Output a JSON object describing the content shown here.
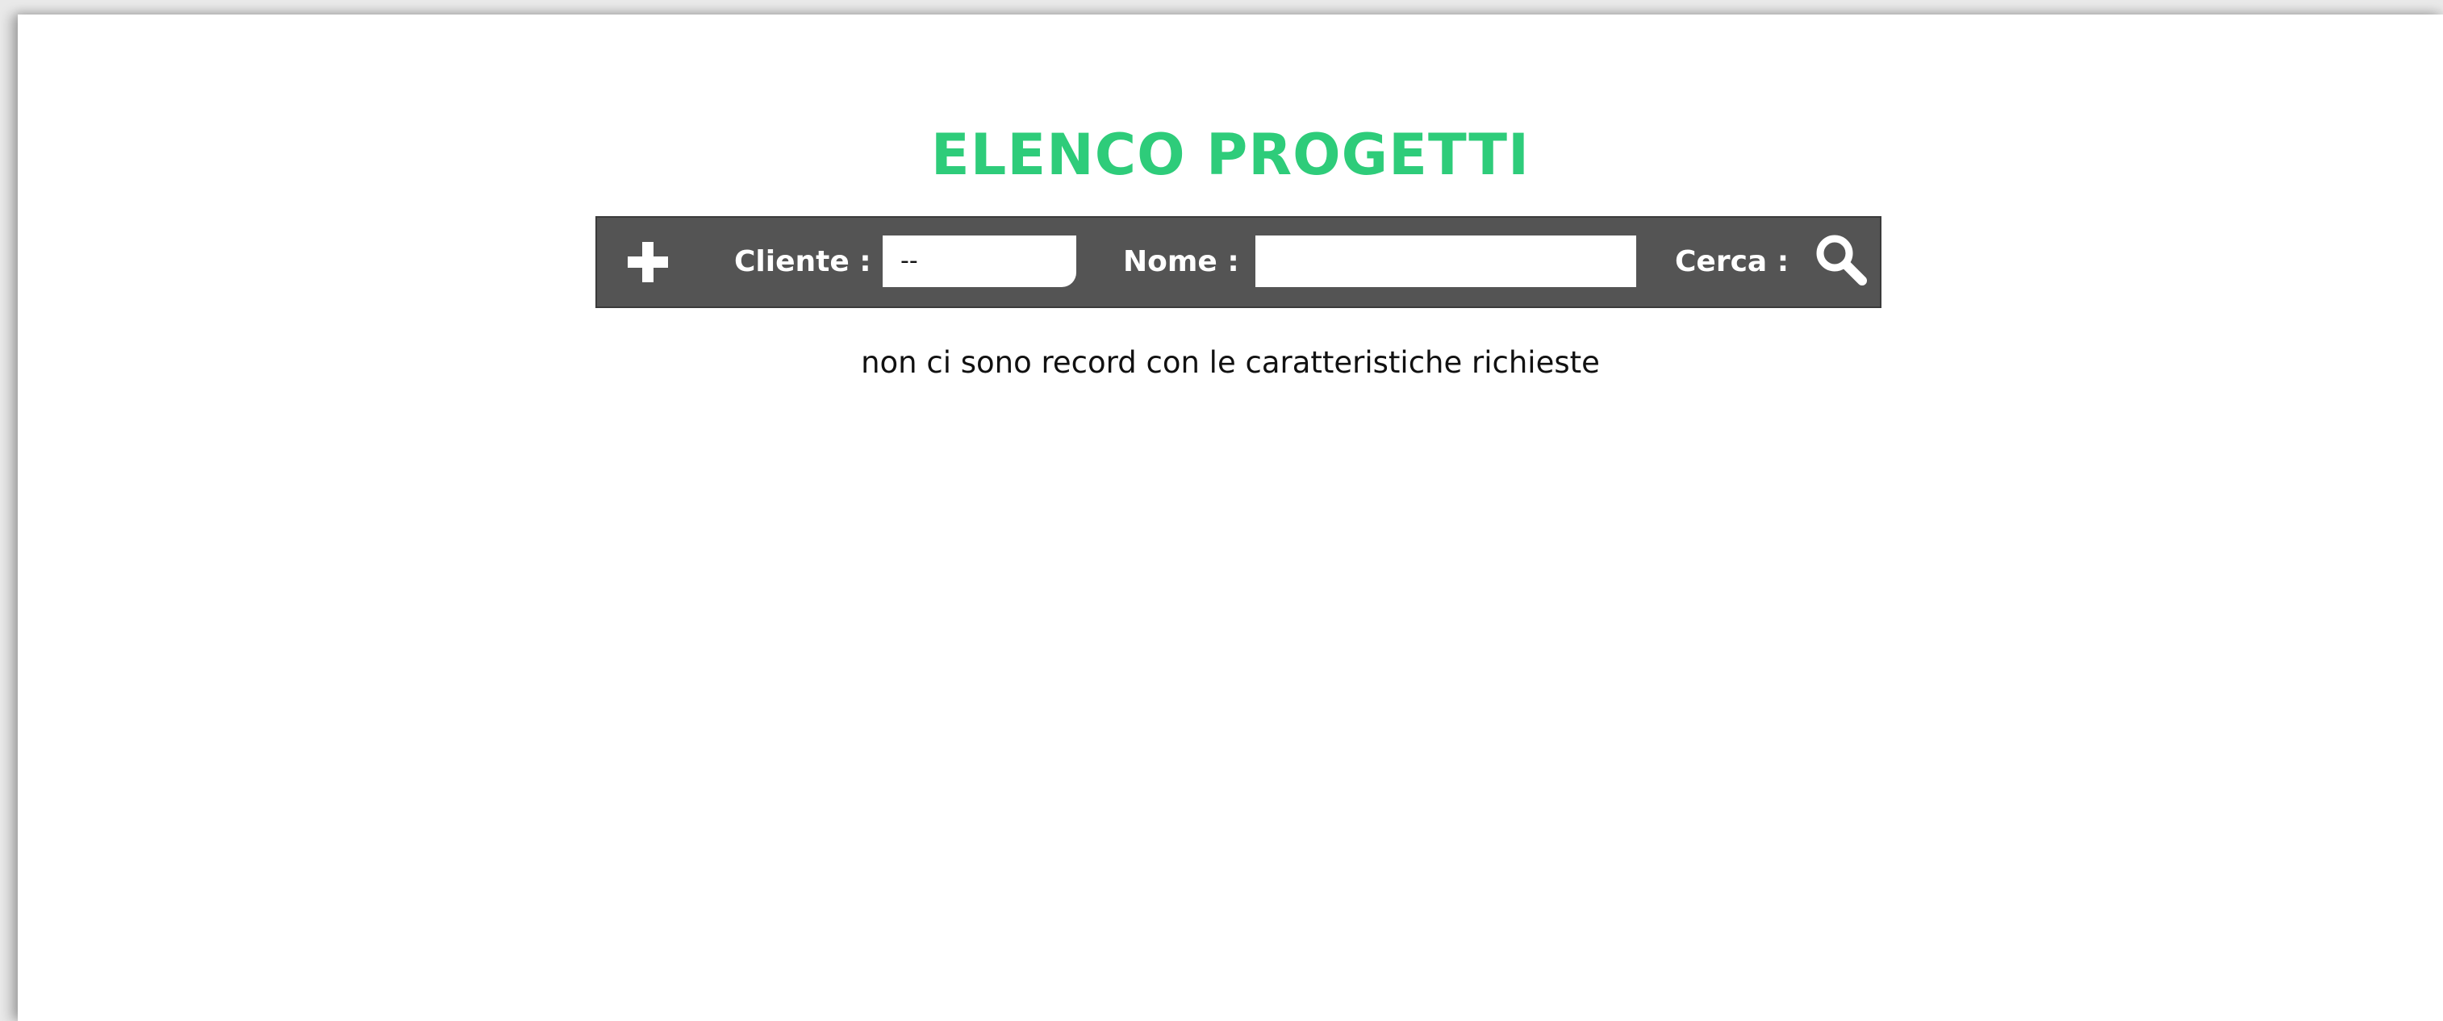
{
  "page": {
    "title": "ELENCO PROGETTI",
    "empty_message": "non ci sono record con le caratteristiche richieste"
  },
  "toolbar": {
    "add_icon": "plus-icon",
    "cliente_label": "Cliente :",
    "cliente_value": "--",
    "nome_label": "Nome :",
    "nome_value": "",
    "cerca_label": "Cerca :",
    "search_icon": "magnifier-icon"
  },
  "colors": {
    "title": "#2ecc7a",
    "toolbar_bg": "#545454",
    "toolbar_text": "#ffffff",
    "page_bg": "#ffffff"
  }
}
